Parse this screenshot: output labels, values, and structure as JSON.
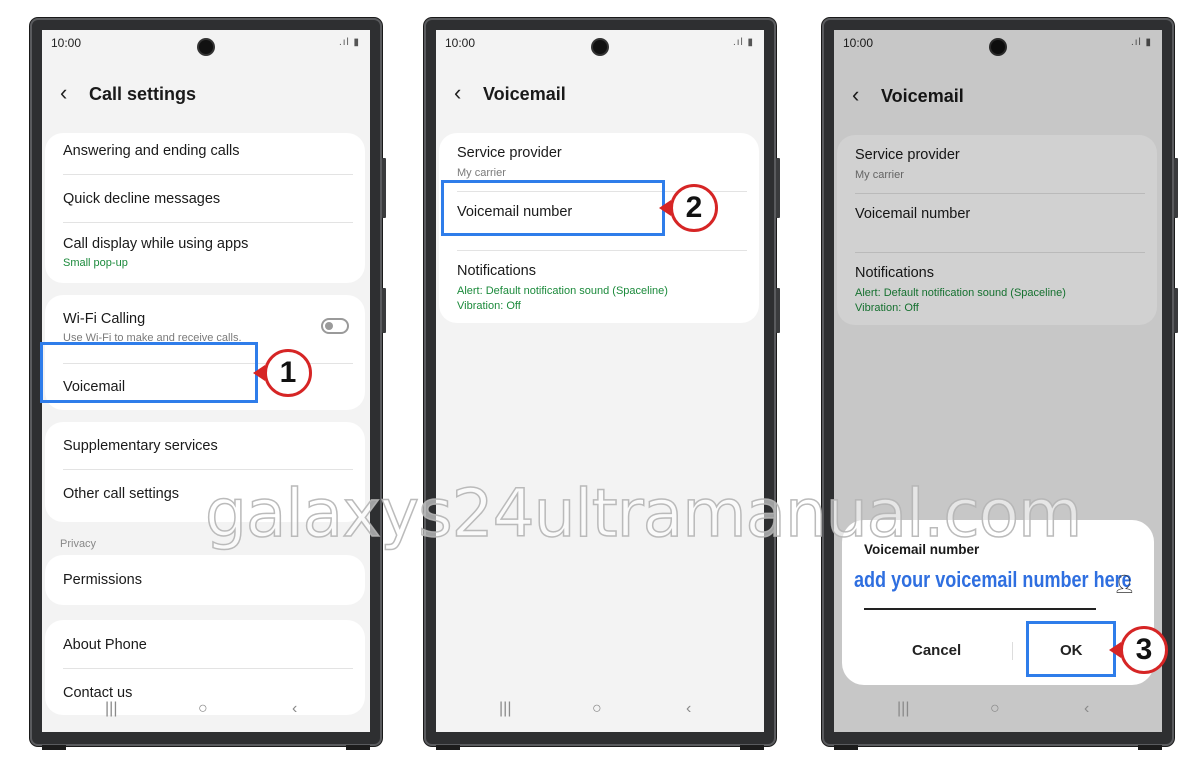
{
  "status": {
    "time": "10:00",
    "icons": ".ıl ▮"
  },
  "nav_icons": {
    "recents": "|||",
    "home": "○",
    "back": "‹"
  },
  "screen1": {
    "title": "Call settings",
    "items": {
      "answering": "Answering and ending calls",
      "quick_decline": "Quick decline messages",
      "call_display": "Call display while using apps",
      "call_display_sub": "Small pop-up",
      "wifi_calling": "Wi-Fi Calling",
      "wifi_calling_sub": "Use Wi-Fi to make and receive calls.",
      "voicemail": "Voicemail",
      "supplementary": "Supplementary services",
      "other": "Other call settings",
      "privacy_section": "Privacy",
      "permissions": "Permissions",
      "about": "About Phone",
      "contact": "Contact us"
    },
    "wifi_calling_enabled": false,
    "step": "1"
  },
  "screen2": {
    "title": "Voicemail",
    "service_provider": "Service provider",
    "service_provider_sub": "My carrier",
    "voicemail_number": "Voicemail number",
    "notifications": "Notifications",
    "notifications_sub1": "Alert: Default notification sound (Spaceline)",
    "notifications_sub2": "Vibration: Off",
    "step": "2"
  },
  "screen3": {
    "title": "Voicemail",
    "service_provider": "Service provider",
    "service_provider_sub": "My carrier",
    "voicemail_number": "Voicemail number",
    "notifications": "Notifications",
    "notifications_sub1": "Alert: Default notification sound (Spaceline)",
    "notifications_sub2": "Vibration: Off",
    "dialog": {
      "title": "Voicemail number",
      "input_value": "add your voicemail number here",
      "cancel": "Cancel",
      "ok": "OK"
    },
    "step": "3"
  },
  "watermark": "galaxys24ultramanual.com",
  "colors": {
    "highlight": "#2f7dea",
    "badge": "#d62525",
    "green_sub": "#1b8a3b",
    "input_text": "#2f6fe0"
  }
}
